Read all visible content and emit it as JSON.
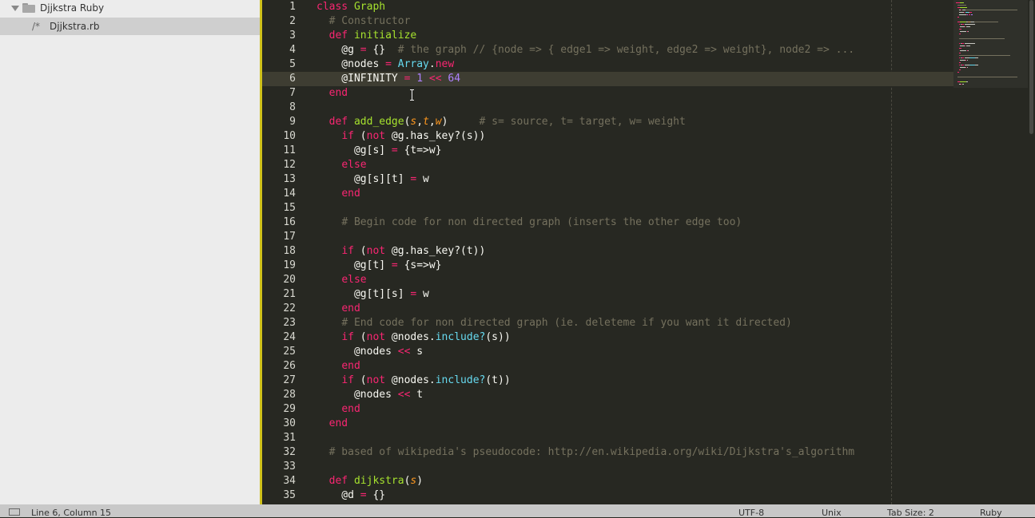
{
  "sidebar": {
    "folder_label": "Djjkstra Ruby",
    "file_label": "Djjkstra.rb",
    "file_icon": "/*"
  },
  "editor": {
    "current_line": 6,
    "lines": [
      {
        "n": "1",
        "t": [
          [
            "kw",
            "class "
          ],
          [
            "cls",
            "Graph"
          ]
        ]
      },
      {
        "n": "2",
        "t": [
          [
            "",
            "  "
          ],
          [
            "cm",
            "# Constructor"
          ]
        ]
      },
      {
        "n": "3",
        "t": [
          [
            "",
            "  "
          ],
          [
            "kw",
            "def "
          ],
          [
            "fn",
            "initialize"
          ]
        ]
      },
      {
        "n": "4",
        "t": [
          [
            "",
            "    @g "
          ],
          [
            "op",
            "="
          ],
          [
            "",
            " {}  "
          ],
          [
            "cm",
            "# the graph // {node => { edge1 => weight, edge2 => weight}, node2 => ..."
          ]
        ]
      },
      {
        "n": "5",
        "t": [
          [
            "",
            "    @nodes "
          ],
          [
            "op",
            "="
          ],
          [
            "",
            " "
          ],
          [
            "const",
            "Array"
          ],
          [
            "",
            "."
          ],
          [
            "kw",
            "new"
          ]
        ]
      },
      {
        "n": "6",
        "t": [
          [
            "",
            "    @INFINITY "
          ],
          [
            "op",
            "="
          ],
          [
            "",
            " "
          ],
          [
            "num",
            "1"
          ],
          [
            "",
            " "
          ],
          [
            "op",
            "<<"
          ],
          [
            "",
            " "
          ],
          [
            "num",
            "64"
          ]
        ]
      },
      {
        "n": "7",
        "t": [
          [
            "",
            "  "
          ],
          [
            "kw",
            "end"
          ]
        ]
      },
      {
        "n": "8",
        "t": []
      },
      {
        "n": "9",
        "t": [
          [
            "",
            "  "
          ],
          [
            "kw",
            "def "
          ],
          [
            "fn",
            "add_edge"
          ],
          [
            "",
            "("
          ],
          [
            "arg",
            "s"
          ],
          [
            "",
            ","
          ],
          [
            "arg",
            "t"
          ],
          [
            "",
            ","
          ],
          [
            "arg",
            "w"
          ],
          [
            "",
            ")     "
          ],
          [
            "cm",
            "# s= source, t= target, w= weight"
          ]
        ]
      },
      {
        "n": "10",
        "t": [
          [
            "",
            "    "
          ],
          [
            "kw",
            "if"
          ],
          [
            "",
            " ("
          ],
          [
            "kw",
            "not"
          ],
          [
            "",
            " @g.has_key?(s))"
          ]
        ]
      },
      {
        "n": "11",
        "t": [
          [
            "",
            "      @g[s] "
          ],
          [
            "op",
            "="
          ],
          [
            "",
            " {t=>w}"
          ]
        ]
      },
      {
        "n": "12",
        "t": [
          [
            "",
            "    "
          ],
          [
            "kw",
            "else"
          ]
        ]
      },
      {
        "n": "13",
        "t": [
          [
            "",
            "      @g[s][t] "
          ],
          [
            "op",
            "="
          ],
          [
            "",
            " w"
          ]
        ]
      },
      {
        "n": "14",
        "t": [
          [
            "",
            "    "
          ],
          [
            "kw",
            "end"
          ]
        ]
      },
      {
        "n": "15",
        "t": []
      },
      {
        "n": "16",
        "t": [
          [
            "",
            "    "
          ],
          [
            "cm",
            "# Begin code for non directed graph (inserts the other edge too)"
          ]
        ]
      },
      {
        "n": "17",
        "t": []
      },
      {
        "n": "18",
        "t": [
          [
            "",
            "    "
          ],
          [
            "kw",
            "if"
          ],
          [
            "",
            " ("
          ],
          [
            "kw",
            "not"
          ],
          [
            "",
            " @g.has_key?(t))"
          ]
        ]
      },
      {
        "n": "19",
        "t": [
          [
            "",
            "      @g[t] "
          ],
          [
            "op",
            "="
          ],
          [
            "",
            " {s=>w}"
          ]
        ]
      },
      {
        "n": "20",
        "t": [
          [
            "",
            "    "
          ],
          [
            "kw",
            "else"
          ]
        ]
      },
      {
        "n": "21",
        "t": [
          [
            "",
            "      @g[t][s] "
          ],
          [
            "op",
            "="
          ],
          [
            "",
            " w"
          ]
        ]
      },
      {
        "n": "22",
        "t": [
          [
            "",
            "    "
          ],
          [
            "kw",
            "end"
          ]
        ]
      },
      {
        "n": "23",
        "t": [
          [
            "",
            "    "
          ],
          [
            "cm",
            "# End code for non directed graph (ie. deleteme if you want it directed)"
          ]
        ]
      },
      {
        "n": "24",
        "t": [
          [
            "",
            "    "
          ],
          [
            "kw",
            "if"
          ],
          [
            "",
            " ("
          ],
          [
            "kw",
            "not"
          ],
          [
            "",
            " @nodes."
          ],
          [
            "meth",
            "include?"
          ],
          [
            "",
            "(s))"
          ]
        ]
      },
      {
        "n": "25",
        "t": [
          [
            "",
            "      @nodes "
          ],
          [
            "op",
            "<<"
          ],
          [
            "",
            " s"
          ]
        ]
      },
      {
        "n": "26",
        "t": [
          [
            "",
            "    "
          ],
          [
            "kw",
            "end"
          ]
        ]
      },
      {
        "n": "27",
        "t": [
          [
            "",
            "    "
          ],
          [
            "kw",
            "if"
          ],
          [
            "",
            " ("
          ],
          [
            "kw",
            "not"
          ],
          [
            "",
            " @nodes."
          ],
          [
            "meth",
            "include?"
          ],
          [
            "",
            "(t))"
          ]
        ]
      },
      {
        "n": "28",
        "t": [
          [
            "",
            "      @nodes "
          ],
          [
            "op",
            "<<"
          ],
          [
            "",
            " t"
          ]
        ]
      },
      {
        "n": "29",
        "t": [
          [
            "",
            "    "
          ],
          [
            "kw",
            "end"
          ]
        ]
      },
      {
        "n": "30",
        "t": [
          [
            "",
            "  "
          ],
          [
            "kw",
            "end"
          ]
        ]
      },
      {
        "n": "31",
        "t": []
      },
      {
        "n": "32",
        "t": [
          [
            "",
            "  "
          ],
          [
            "cm",
            "# based of wikipedia's pseudocode: http://en.wikipedia.org/wiki/Dijkstra's_algorithm"
          ]
        ]
      },
      {
        "n": "33",
        "t": []
      },
      {
        "n": "34",
        "t": [
          [
            "",
            "  "
          ],
          [
            "kw",
            "def "
          ],
          [
            "fn",
            "dijkstra"
          ],
          [
            "",
            "("
          ],
          [
            "arg",
            "s"
          ],
          [
            "",
            ")"
          ]
        ]
      },
      {
        "n": "35",
        "t": [
          [
            "",
            "    @d "
          ],
          [
            "op",
            "="
          ],
          [
            "",
            " {}"
          ]
        ]
      }
    ]
  },
  "status": {
    "position": "Line 6, Column 15",
    "encoding": "UTF-8",
    "line_endings": "Unix",
    "tab_size": "Tab Size: 2",
    "syntax": "Ruby"
  },
  "colors": {
    "accent_bar": "#cfc11b",
    "editor_bg": "#272822",
    "keyword": "#f92672",
    "function": "#a6e22e",
    "comment": "#75715e"
  },
  "icons": [
    "chevron-down-icon",
    "folder-icon",
    "file-icon",
    "panel-toggle-icon",
    "text-cursor-icon"
  ]
}
